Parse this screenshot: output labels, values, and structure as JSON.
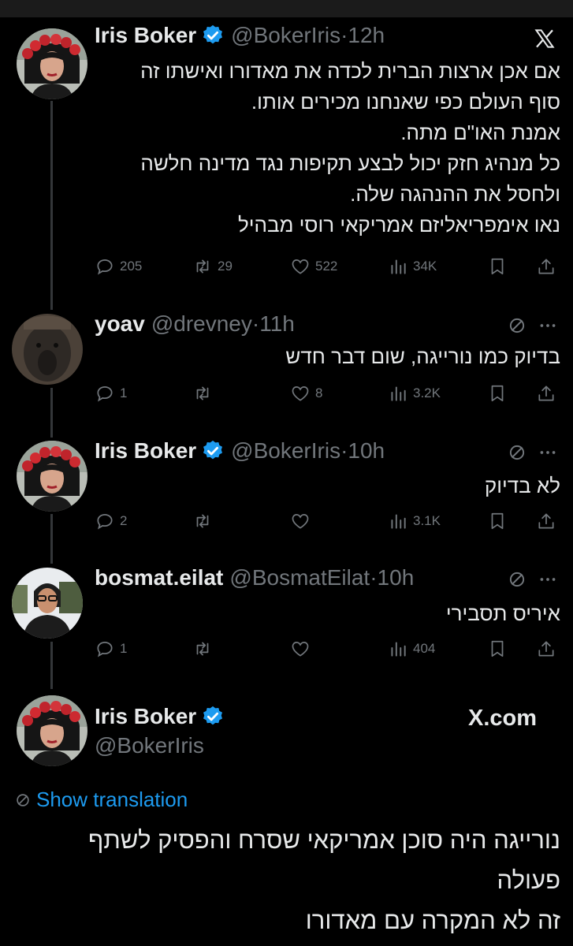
{
  "tweets": [
    {
      "name": "Iris Boker",
      "handle": "@BokerIris",
      "time": "12h",
      "lines": [
        "אם אכן ארצות הברית לכדה את מאדורו ואישתו זה",
        "סוף העולם כפי שאנחנו מכירים אותו.",
        "אמנת האו\"ם מתה.",
        "כל מנהיג חזק יכול לבצע תקיפות נגד מדינה חלשה",
        "ולחסל את ההנהגה שלה.",
        "נאו אימפריאליזם אמריקאי רוסי מבהיל"
      ],
      "replies": "205",
      "reposts": "29",
      "likes": "522",
      "views": "34K"
    },
    {
      "name": "yoav",
      "handle": "@drevney",
      "time": "11h",
      "lines": [
        "בדיוק כמו נורייגה, שום דבר חדש"
      ],
      "replies": "1",
      "reposts": "",
      "likes": "8",
      "views": "3.2K"
    },
    {
      "name": "Iris Boker",
      "handle": "@BokerIris",
      "time": "10h",
      "lines": [
        "לא בדיוק"
      ],
      "replies": "2",
      "reposts": "",
      "likes": "",
      "views": "3.1K"
    },
    {
      "name": "bosmat.eilat",
      "handle": "@BosmatEilat",
      "time": "10h",
      "lines": [
        "איריס תסבירי"
      ],
      "replies": "1",
      "reposts": "",
      "likes": "",
      "views": "404"
    }
  ],
  "quote": {
    "name": "Iris Boker",
    "handle": "@BokerIris",
    "site": "X.com",
    "show_translation": "Show translation",
    "lines": [
      "נורייגה היה סוכן אמריקאי שסרח והפסיק לשתף",
      "פעולה",
      "זה לא המקרה עם מאדורו"
    ]
  },
  "colors": {
    "background": "#000000",
    "text": "#e7e9ea",
    "muted": "#71767b",
    "verified": "#1d9bf0",
    "link": "#1d9bf0"
  },
  "icons": [
    "x-logo-icon",
    "verified-badge-icon",
    "reply-icon",
    "repost-icon",
    "like-icon",
    "views-icon",
    "bookmark-icon",
    "share-icon",
    "translate-icon",
    "more-icon"
  ]
}
